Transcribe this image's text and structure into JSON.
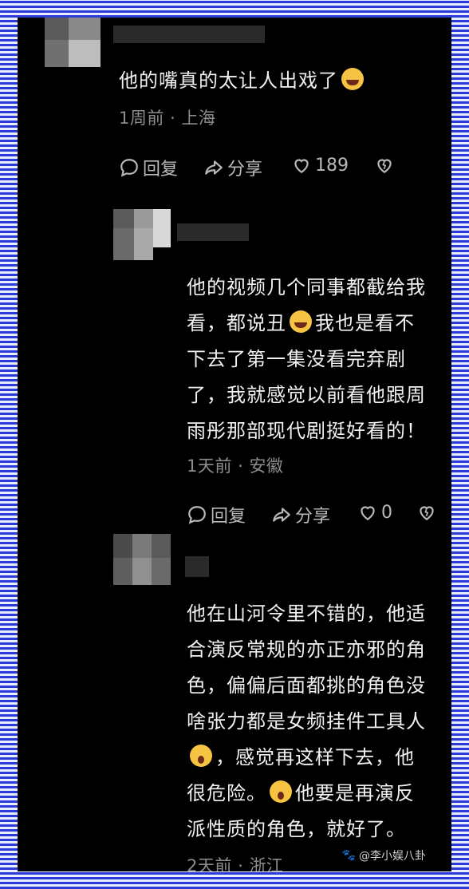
{
  "comments": [
    {
      "lines": [
        "他的嘴真的太让人出戏了"
      ],
      "emoji": "laugh-cry-emoji",
      "time": "1周前",
      "location": "上海",
      "reply_label": "回复",
      "share_label": "分享",
      "likes": "189"
    },
    {
      "lines": [
        "他的视频几个同事都截给我",
        "看，都说丑",
        "我也是看不",
        "下去了第一集没看完弃剧",
        "了，我就感觉以前看他跟周",
        "雨彤那部现代剧挺好看的！"
      ],
      "time": "1天前",
      "location": "安徽",
      "reply_label": "回复",
      "share_label": "分享",
      "likes": "0"
    },
    {
      "lines": [
        "他在山河令里不错的，他适",
        "合演反常规的亦正亦邪的角",
        "色，偏偏后面都挑的角色没",
        "啥张力都是女频挂件工具人",
        "，感觉再这样下去，他",
        "很危险。",
        "他要是再演反",
        "派性质的角色，就好了。"
      ],
      "time": "2天前",
      "location": "浙江"
    }
  ],
  "meta_separator": "·",
  "watermark": "@李小娱八卦",
  "colors": {
    "background": "#000000",
    "frame": "#2d3bd6",
    "text": "#f1f1f1",
    "meta": "#8d8d8d"
  }
}
